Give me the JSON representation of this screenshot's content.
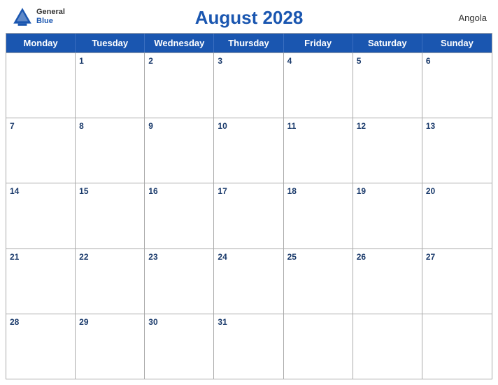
{
  "header": {
    "title": "August 2028",
    "country": "Angola",
    "logo_general": "General",
    "logo_blue": "Blue"
  },
  "days": [
    "Monday",
    "Tuesday",
    "Wednesday",
    "Thursday",
    "Friday",
    "Saturday",
    "Sunday"
  ],
  "weeks": [
    [
      {
        "num": "",
        "empty": true
      },
      {
        "num": "1"
      },
      {
        "num": "2"
      },
      {
        "num": "3"
      },
      {
        "num": "4"
      },
      {
        "num": "5"
      },
      {
        "num": "6"
      }
    ],
    [
      {
        "num": "7"
      },
      {
        "num": "8"
      },
      {
        "num": "9"
      },
      {
        "num": "10"
      },
      {
        "num": "11"
      },
      {
        "num": "12"
      },
      {
        "num": "13"
      }
    ],
    [
      {
        "num": "14"
      },
      {
        "num": "15"
      },
      {
        "num": "16"
      },
      {
        "num": "17"
      },
      {
        "num": "18"
      },
      {
        "num": "19"
      },
      {
        "num": "20"
      }
    ],
    [
      {
        "num": "21"
      },
      {
        "num": "22"
      },
      {
        "num": "23"
      },
      {
        "num": "24"
      },
      {
        "num": "25"
      },
      {
        "num": "26"
      },
      {
        "num": "27"
      }
    ],
    [
      {
        "num": "28"
      },
      {
        "num": "29"
      },
      {
        "num": "30"
      },
      {
        "num": "31"
      },
      {
        "num": "",
        "empty": true
      },
      {
        "num": "",
        "empty": true
      },
      {
        "num": "",
        "empty": true
      }
    ]
  ],
  "colors": {
    "primary": "#1a56b0",
    "text_dark": "#1a3a6b",
    "border": "#aaa"
  }
}
